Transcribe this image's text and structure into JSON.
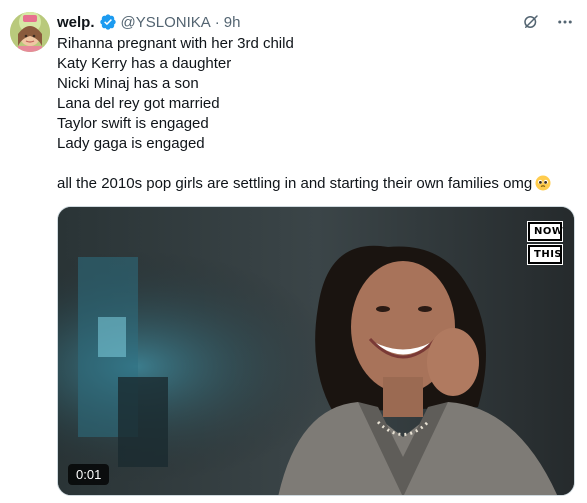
{
  "tweet": {
    "display_name": "welp.",
    "handle": "@YSLONIKA",
    "separator": "·",
    "time": "9h",
    "lines": [
      "Rihanna pregnant with her 3rd child",
      "Katy Kerry has a daughter",
      "Nicki Minaj has a son",
      "Lana del rey got married",
      "Taylor swift is engaged",
      "Lady gaga is engaged"
    ],
    "closing_line": "all the 2010s pop girls are settling in and starting their own families omg",
    "closing_emoji": "pleading-face-emoji"
  },
  "media": {
    "brand_line1": "NOW",
    "brand_line2": "THIS",
    "duration": "0:01"
  },
  "icons": {
    "verified": "verified-badge-icon",
    "grok": "grok-icon",
    "more": "more-icon"
  },
  "colors": {
    "verified_blue": "#1d9bf0",
    "secondary_text": "#536471",
    "primary_text": "#0f1419"
  }
}
